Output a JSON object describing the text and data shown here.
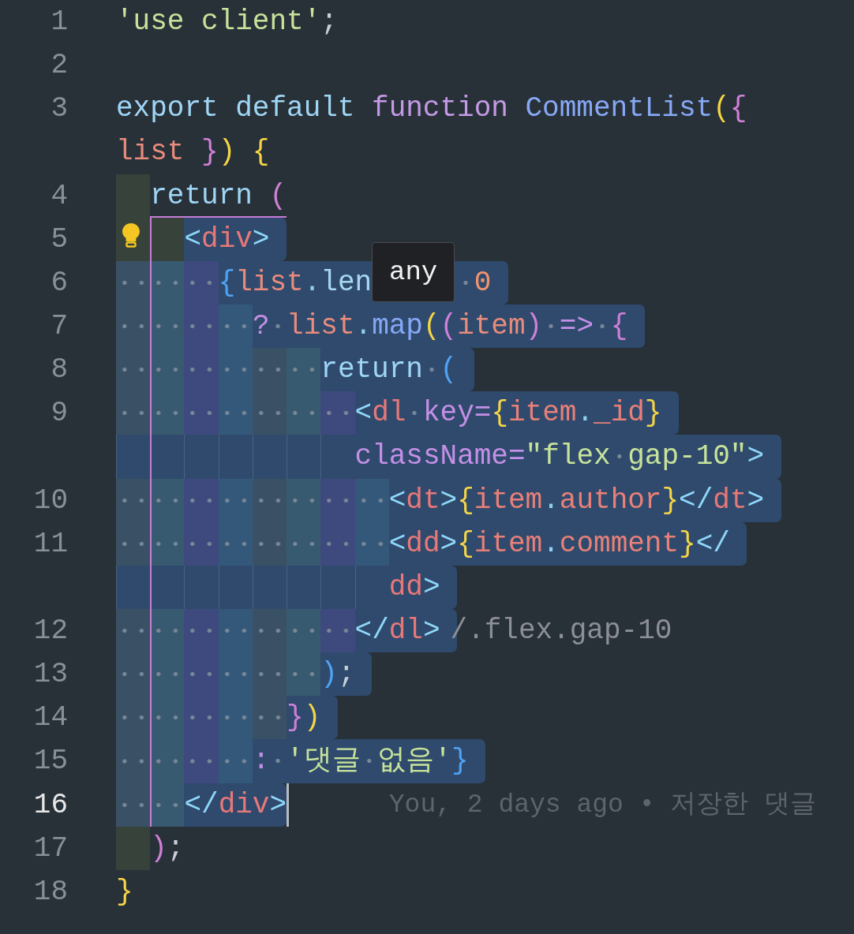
{
  "editor": {
    "lines": [
      {
        "number": "1",
        "selected": false,
        "rows": [
          {
            "tokens": [
              {
                "kind": "str",
                "text": "'use client'"
              },
              {
                "kind": "punc",
                "text": ";"
              }
            ]
          }
        ]
      },
      {
        "number": "2",
        "selected": false,
        "rows": [
          {
            "tokens": []
          }
        ]
      },
      {
        "number": "3",
        "selected": false,
        "rows": [
          {
            "tokens": [
              {
                "kind": "kw",
                "text": "export"
              },
              {
                "kind": "kw",
                "text": " default"
              },
              {
                "kind": "fn",
                "text": " function"
              },
              {
                "kind": "name",
                "text": " CommentList"
              },
              {
                "kind": "b1",
                "text": "("
              },
              {
                "kind": "b2",
                "text": "{"
              }
            ]
          },
          {
            "tokens": [
              {
                "kind": "param",
                "text": "list"
              },
              {
                "kind": "b2",
                "text": " }"
              },
              {
                "kind": "b1",
                "text": ")"
              },
              {
                "kind": "b1",
                "text": " {"
              }
            ]
          }
        ]
      },
      {
        "number": "4",
        "selected": false,
        "scope": true,
        "guide_start": true,
        "rows": [
          {
            "tokens": [
              {
                "kind": "kw",
                "text": "  return"
              },
              {
                "kind": "b2",
                "text": " ("
              }
            ]
          }
        ]
      },
      {
        "number": "5",
        "selected": true,
        "selection_from_text": true,
        "scope": true,
        "guide": true,
        "lightbulb": true,
        "rows": [
          {
            "tokens": [
              {
                "kind": "tag",
                "text": "    <"
              },
              {
                "kind": "tagname",
                "text": "div"
              },
              {
                "kind": "tag",
                "text": ">"
              }
            ]
          }
        ]
      },
      {
        "number": "6",
        "selected": true,
        "guide": true,
        "rows": [
          {
            "tokens": [
              {
                "kind": "b3",
                "text": "      {"
              },
              {
                "kind": "param",
                "text": "list"
              },
              {
                "kind": "dot",
                "text": "."
              },
              {
                "kind": "member",
                "text": "len"
              },
              {
                "kind": "tooltip",
                "text": "any"
              },
              {
                "kind": "num",
                "text": " 0"
              }
            ]
          }
        ]
      },
      {
        "number": "7",
        "selected": true,
        "guide": true,
        "rows": [
          {
            "tokens": [
              {
                "kind": "op",
                "text": "        ?"
              },
              {
                "kind": "param",
                "text": " list"
              },
              {
                "kind": "dot",
                "text": "."
              },
              {
                "kind": "method",
                "text": "map"
              },
              {
                "kind": "b1",
                "text": "("
              },
              {
                "kind": "b2",
                "text": "("
              },
              {
                "kind": "param",
                "text": "item"
              },
              {
                "kind": "b2",
                "text": ")"
              },
              {
                "kind": "op",
                "text": " =>"
              },
              {
                "kind": "b2",
                "text": " {"
              }
            ]
          }
        ]
      },
      {
        "number": "8",
        "selected": true,
        "guide": true,
        "rows": [
          {
            "tokens": [
              {
                "kind": "kw",
                "text": "            return"
              },
              {
                "kind": "b3",
                "text": " ("
              }
            ]
          }
        ]
      },
      {
        "number": "9",
        "selected": true,
        "guide": true,
        "rows": [
          {
            "tokens": [
              {
                "kind": "tag",
                "text": "              <"
              },
              {
                "kind": "tagname",
                "text": "dl"
              },
              {
                "kind": "attr",
                "text": " key="
              },
              {
                "kind": "b1",
                "text": "{"
              },
              {
                "kind": "prop",
                "text": "item"
              },
              {
                "kind": "dot",
                "text": "."
              },
              {
                "kind": "prop",
                "text": "_id"
              },
              {
                "kind": "b1",
                "text": "}"
              }
            ]
          },
          {
            "tokens": [
              {
                "kind": "attr",
                "text": "className="
              },
              {
                "kind": "str",
                "text": "\"flex gap-10\""
              },
              {
                "kind": "tag",
                "text": ">"
              }
            ]
          }
        ]
      },
      {
        "number": "10",
        "selected": true,
        "guide": true,
        "rows": [
          {
            "tokens": [
              {
                "kind": "tag",
                "text": "                <"
              },
              {
                "kind": "tagname",
                "text": "dt"
              },
              {
                "kind": "tag",
                "text": ">"
              },
              {
                "kind": "b1",
                "text": "{"
              },
              {
                "kind": "prop",
                "text": "item"
              },
              {
                "kind": "dot",
                "text": "."
              },
              {
                "kind": "prop",
                "text": "author"
              },
              {
                "kind": "b1",
                "text": "}"
              },
              {
                "kind": "tag",
                "text": "</"
              },
              {
                "kind": "tagname",
                "text": "dt"
              },
              {
                "kind": "tag",
                "text": ">"
              }
            ]
          }
        ]
      },
      {
        "number": "11",
        "selected": true,
        "guide": true,
        "rows": [
          {
            "tokens": [
              {
                "kind": "tag",
                "text": "                <"
              },
              {
                "kind": "tagname",
                "text": "dd"
              },
              {
                "kind": "tag",
                "text": ">"
              },
              {
                "kind": "b1",
                "text": "{"
              },
              {
                "kind": "prop",
                "text": "item"
              },
              {
                "kind": "dot",
                "text": "."
              },
              {
                "kind": "prop",
                "text": "comment"
              },
              {
                "kind": "b1",
                "text": "}"
              },
              {
                "kind": "tag",
                "text": "</"
              }
            ]
          },
          {
            "tokens": [
              {
                "kind": "tagname",
                "text": "dd"
              },
              {
                "kind": "tag",
                "text": ">"
              }
            ]
          }
        ]
      },
      {
        "number": "12",
        "selected": true,
        "guide": true,
        "hint": "/.flex.gap-10",
        "rows": [
          {
            "tokens": [
              {
                "kind": "tag",
                "text": "              </"
              },
              {
                "kind": "tagname",
                "text": "dl"
              },
              {
                "kind": "tag",
                "text": ">"
              }
            ]
          }
        ]
      },
      {
        "number": "13",
        "selected": true,
        "guide": true,
        "rows": [
          {
            "tokens": [
              {
                "kind": "b3",
                "text": "            )"
              },
              {
                "kind": "punc",
                "text": ";"
              }
            ]
          }
        ]
      },
      {
        "number": "14",
        "selected": true,
        "guide": true,
        "rows": [
          {
            "tokens": [
              {
                "kind": "b2",
                "text": "          }"
              },
              {
                "kind": "b1",
                "text": ")"
              }
            ]
          }
        ]
      },
      {
        "number": "15",
        "selected": true,
        "guide": true,
        "rows": [
          {
            "tokens": [
              {
                "kind": "op",
                "text": "        :"
              },
              {
                "kind": "str",
                "text": " '댓글 없음'"
              },
              {
                "kind": "b3",
                "text": "}"
              }
            ]
          }
        ]
      },
      {
        "number": "16",
        "selected": true,
        "guide": true,
        "current": true,
        "cursor": true,
        "blame": "You, 2 days ago • 저장한 댓글",
        "rows": [
          {
            "tokens": [
              {
                "kind": "tag",
                "text": "    </"
              },
              {
                "kind": "tagname",
                "text": "div"
              },
              {
                "kind": "tag",
                "text": ">"
              }
            ]
          }
        ]
      },
      {
        "number": "17",
        "selected": false,
        "scope": true,
        "rows": [
          {
            "tokens": [
              {
                "kind": "b2",
                "text": "  )"
              },
              {
                "kind": "punc",
                "text": ";"
              }
            ]
          }
        ]
      },
      {
        "number": "18",
        "selected": false,
        "rows": [
          {
            "tokens": [
              {
                "kind": "b1",
                "text": "}"
              }
            ]
          }
        ]
      }
    ]
  }
}
